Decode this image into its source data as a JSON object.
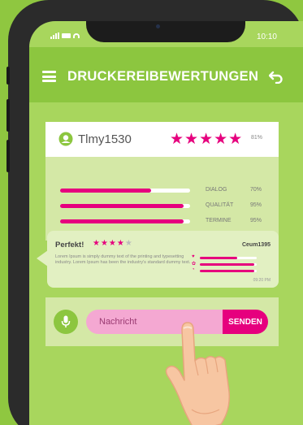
{
  "status": {
    "time": "10:10"
  },
  "header": {
    "title": "DRUCKEREIBEWERTUNGEN",
    "menu_icon": "hamburger-icon",
    "back_icon": "back-arrow-icon"
  },
  "rating_card": {
    "username": "Tlmy1530",
    "stars": 5,
    "overall_pct": "81%",
    "bars": [
      {
        "label": "DIALOG",
        "pct": "70%",
        "value": 0.7
      },
      {
        "label": "QUALITÄT",
        "pct": "95%",
        "value": 0.95
      },
      {
        "label": "TERMINE",
        "pct": "95%",
        "value": 0.95
      }
    ]
  },
  "review_card": {
    "title": "Perfekt!",
    "stars": 4,
    "user": "Ceum1395",
    "text": "Lorem Ipsum is simply dummy text of the printing and typesetting industry. Lorem Ipsum has been the industry's standard dummy text.",
    "time": "09:20 PM",
    "mini_bars": [
      0.65,
      0.95,
      0.95
    ]
  },
  "message": {
    "placeholder": "Nachricht",
    "send_label": "SENDEN"
  },
  "colors": {
    "accent": "#e6007e",
    "background": "#8fc740",
    "header": "#8cc63f"
  }
}
